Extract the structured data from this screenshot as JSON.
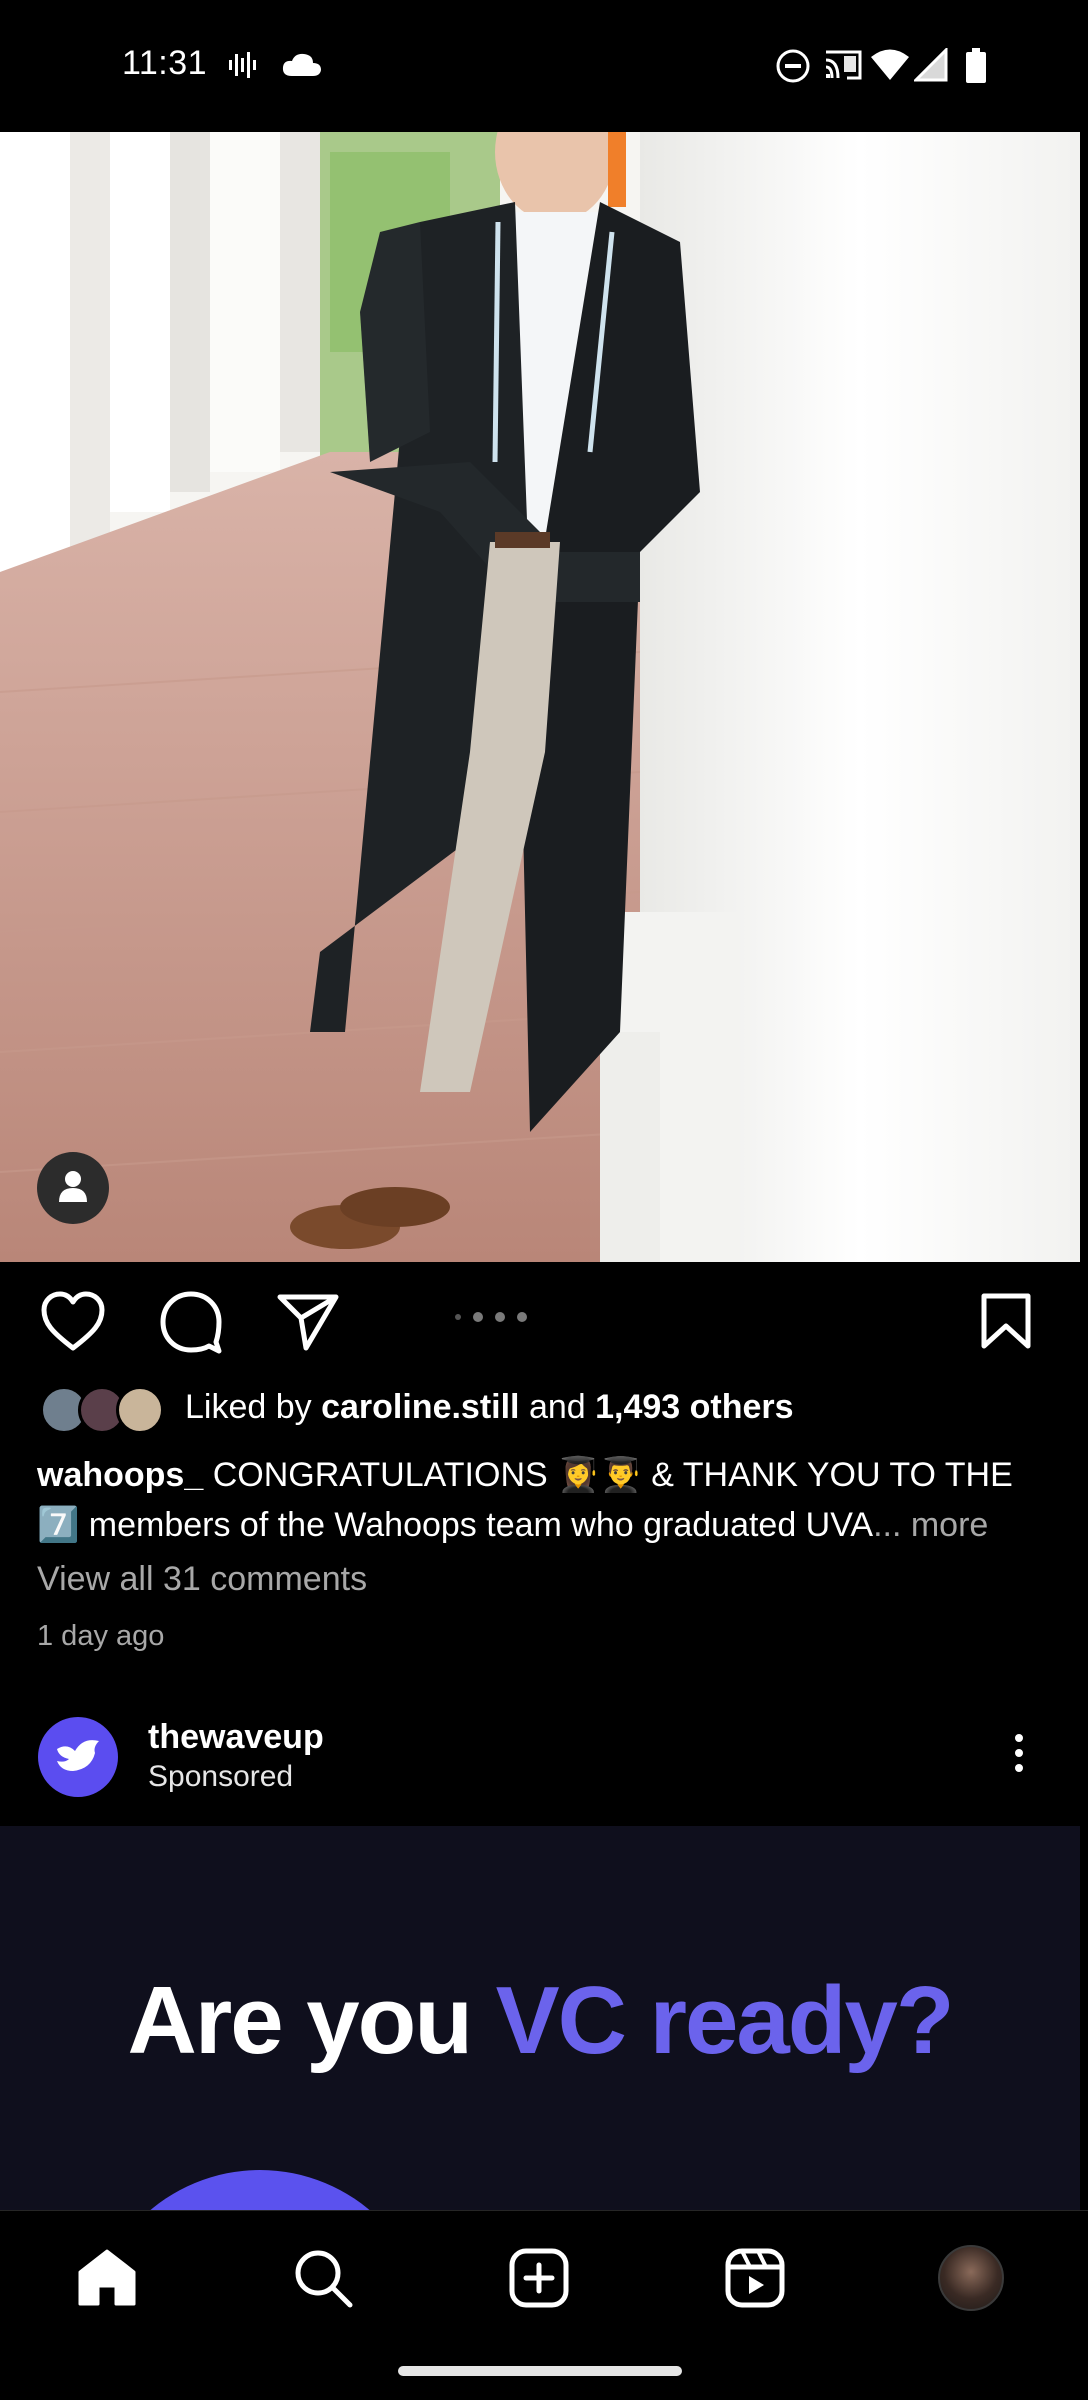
{
  "status_bar": {
    "time": "11:31",
    "icons": [
      "voicemail-icon",
      "cloud-icon",
      "dnd-icon",
      "cast-icon",
      "wifi-icon",
      "signal-icon",
      "battery-icon"
    ]
  },
  "post": {
    "photo_alt": "Graduate in black gown leaning against a white column",
    "actions": {
      "like_icon": "heart-icon",
      "comment_icon": "comment-icon",
      "share_icon": "send-icon",
      "save_icon": "bookmark-icon"
    },
    "carousel_dots": 4,
    "likes": {
      "prefix": "Liked by ",
      "user": "caroline.still",
      "middle": " and ",
      "others": "1,493 others"
    },
    "caption": {
      "username": "wahoops_",
      "text": " CONGRATULATIONS 👩‍🎓👨‍🎓 & THANK YOU TO THE 7️⃣ members of the Wahoops team who graduated UVA",
      "more": "... more"
    },
    "view_comments": "View all 31 comments",
    "time_ago": "1 day ago"
  },
  "sponsored": {
    "account": "thewaveup",
    "label": "Sponsored",
    "ad_title_plain": "Are you ",
    "ad_title_accent": "VC ready?"
  },
  "bottom_nav": {
    "items": [
      "home-icon",
      "search-icon",
      "create-icon",
      "reels-icon",
      "profile-avatar"
    ]
  },
  "colors": {
    "accent": "#6b63ec",
    "background": "#000000",
    "secondary_text": "#a8a8a8"
  }
}
